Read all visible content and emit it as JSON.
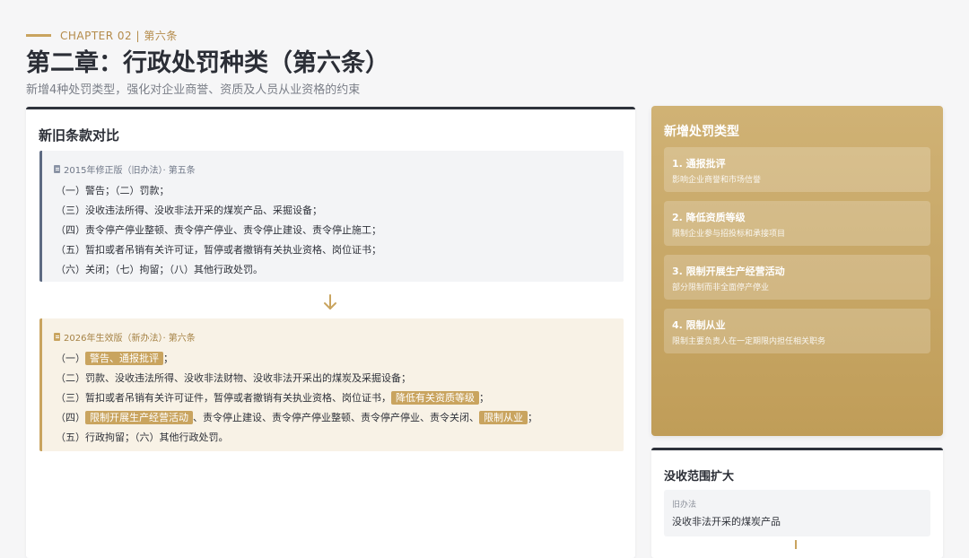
{
  "header": {
    "eyebrow": "CHAPTER 02 | 第六条",
    "title": "第二章：行政处罚种类（第六条）",
    "subtitle": "新增4种处罚类型，强化对企业商誉、资质及人员从业资格的约束"
  },
  "comparison": {
    "title": "新旧条款对比",
    "old": {
      "label": "2015年修正版（旧办法）· 第五条",
      "lines": [
        "（一）警告；（二）罚款；",
        "（三）没收违法所得、没收非法开采的煤炭产品、采掘设备；",
        "（四）责令停产停业整顿、责令停产停业、责令停止建设、责令停止施工；",
        "（五）暂扣或者吊销有关许可证，暂停或者撤销有关执业资格、岗位证书；",
        "（六）关闭；（七）拘留；（八）其他行政处罚。"
      ]
    },
    "new": {
      "label": "2026年生效版（新办法）· 第六条",
      "l1": {
        "a": "（一）",
        "hl": "警告、通报批评",
        "b": "；"
      },
      "l2": "（二）罚款、没收违法所得、没收非法财物、没收非法开采出的煤炭及采掘设备；",
      "l3": {
        "a": "（三）暂扣或者吊销有关许可证件，暂停或者撤销有关执业资格、岗位证书，",
        "hl": "降低有关资质等级",
        "b": "；"
      },
      "l4": {
        "a": "（四）",
        "hl1": "限制开展生产经营活动",
        "b": "、责令停止建设、责令停产停业整顿、责令停产停业、责令关闭、",
        "hl2": "限制从业",
        "c": "；"
      },
      "l5": "（五）行政拘留；（六）其他行政处罚。"
    }
  },
  "new_types": {
    "title": "新增处罚类型",
    "items": [
      {
        "title": "1. 通报批评",
        "desc": "影响企业商誉和市场信誉"
      },
      {
        "title": "2. 降低资质等级",
        "desc": "限制企业参与招投标和承接项目"
      },
      {
        "title": "3. 限制开展生产经营活动",
        "desc": "部分限制而非全面停产停业"
      },
      {
        "title": "4. 限制从业",
        "desc": "限制主要负责人在一定期限内担任相关职务"
      }
    ]
  },
  "confiscation": {
    "title": "没收范围扩大",
    "old_label": "旧办法",
    "old_value": "没收非法开采的煤炭产品"
  },
  "colors": {
    "gold": "#c9a45f",
    "dark": "#2e323b",
    "slate": "#5d6a82"
  }
}
